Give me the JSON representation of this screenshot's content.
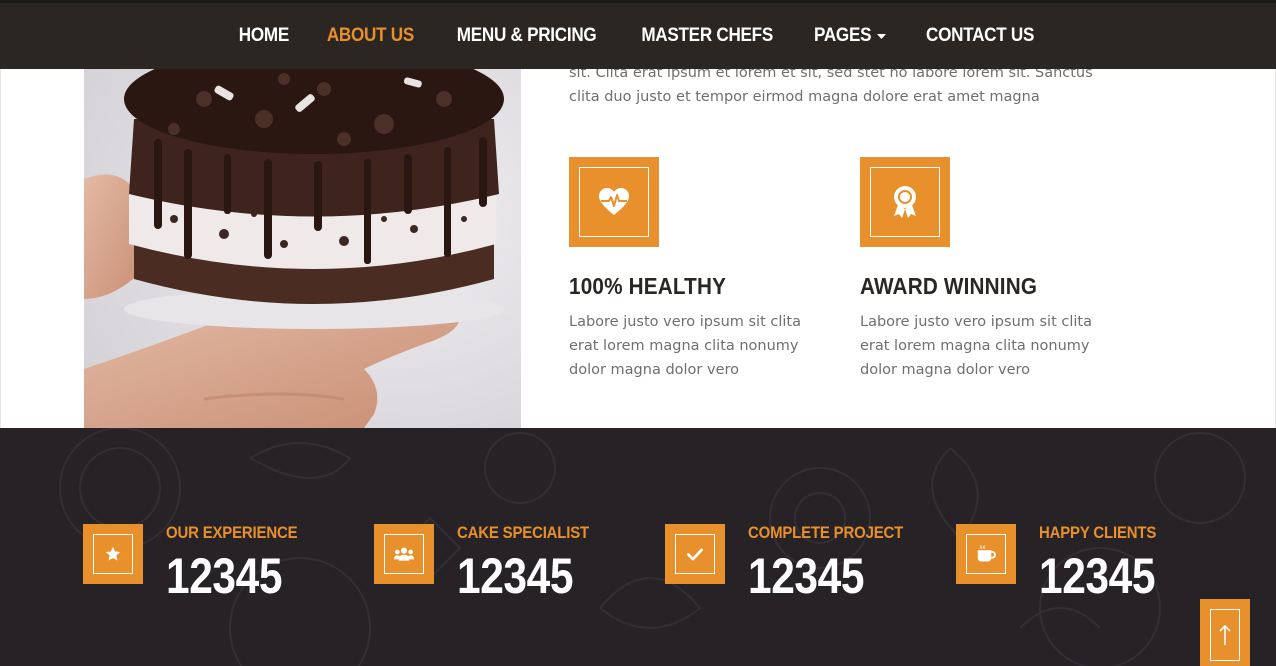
{
  "nav": {
    "items": [
      {
        "label": "HOME",
        "active": false
      },
      {
        "label": "ABOUT US",
        "active": true
      },
      {
        "label": "MENU & PRICING",
        "active": false
      },
      {
        "label": "MASTER CHEFS",
        "active": false
      },
      {
        "label": "PAGES",
        "active": false,
        "dropdown": true
      },
      {
        "label": "CONTACT US",
        "active": false
      }
    ]
  },
  "about": {
    "intro_line1": "sit. Clita erat ipsum et lorem et sit, sed stet no labore lorem sit. Sanctus",
    "intro_line2": "clita duo justo et tempor eirmod magna dolore erat amet magna",
    "features": [
      {
        "icon": "heart-pulse-icon",
        "title": "100% HEALTHY",
        "text": "Labore justo vero ipsum sit clita erat lorem magna clita nonumy dolor magna dolor vero"
      },
      {
        "icon": "award-icon",
        "title": "AWARD WINNING",
        "text": "Labore justo vero ipsum sit clita erat lorem magna clita nonumy dolor magna dolor vero"
      }
    ]
  },
  "stats": [
    {
      "icon": "star-icon",
      "label": "OUR EXPERIENCE",
      "value": "12345"
    },
    {
      "icon": "users-icon",
      "label": "CAKE SPECIALIST",
      "value": "12345"
    },
    {
      "icon": "check-icon",
      "label": "COMPLETE PROJECT",
      "value": "12345"
    },
    {
      "icon": "coffee-cup-icon",
      "label": "HAPPY CLIENTS",
      "value": "12345"
    }
  ],
  "colors": {
    "accent": "#e8902b",
    "dark": "#262226",
    "nav_bg": "#2b2622"
  },
  "back_to_top": {
    "icon": "arrow-up-icon"
  }
}
